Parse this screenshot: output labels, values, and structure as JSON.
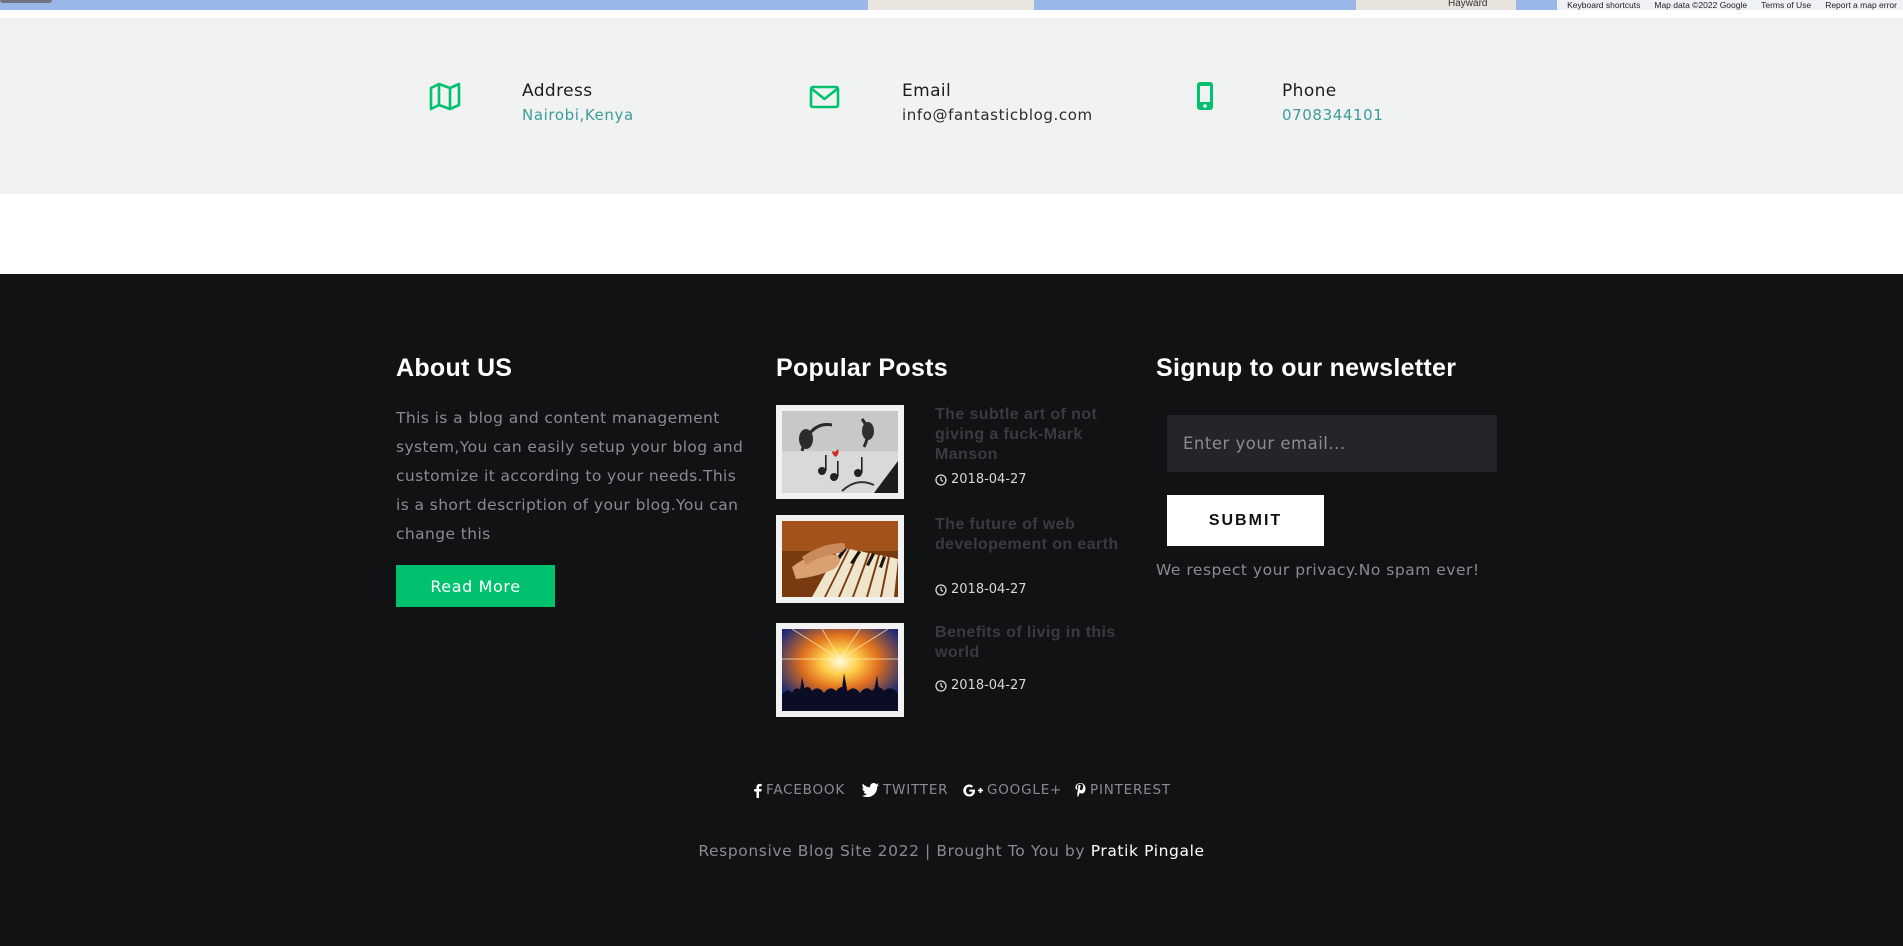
{
  "map": {
    "place_label": "Hayward",
    "attribution": [
      "Keyboard shortcuts",
      "Map data ©2022 Google",
      "Terms of Use",
      "Report a map error"
    ]
  },
  "contact": {
    "address": {
      "title": "Address",
      "value": "Nairobi,Kenya",
      "icon": "map-icon"
    },
    "email": {
      "title": "Email",
      "value": "info@fantasticblog.com",
      "icon": "envelope-icon"
    },
    "phone": {
      "title": "Phone",
      "value": "0708344101",
      "icon": "mobile-phone-icon"
    },
    "accent_color": "#00c16e"
  },
  "footer": {
    "about": {
      "title": "About US",
      "text": "This is a blog and content management system,You can easily setup your blog and customize it according to your needs.This is a short description of your blog.You can change this",
      "button": "Read More"
    },
    "popular": {
      "title": "Popular Posts",
      "posts": [
        {
          "title": "The subtle art of not giving a fuck-Mark Manson",
          "date": "2018-04-27",
          "image": "headphones-music-notes"
        },
        {
          "title": "The future of web developement on earth",
          "date": "2018-04-27",
          "image": "hands-on-piano"
        },
        {
          "title": "Benefits of livig in this world",
          "date": "2018-04-27",
          "image": "concert-lights"
        }
      ]
    },
    "newsletter": {
      "title": "Signup to our newsletter",
      "placeholder": "Enter your email...",
      "button": "SUBMIT",
      "note": "We respect your privacy.No spam ever!"
    },
    "social": [
      {
        "label": "FACEBOOK",
        "icon": "facebook-icon"
      },
      {
        "label": "TWITTER",
        "icon": "twitter-icon"
      },
      {
        "label": "GOOGLE+",
        "icon": "google-plus-icon"
      },
      {
        "label": "PINTEREST",
        "icon": "pinterest-icon"
      }
    ],
    "copyright": {
      "text": "Responsive Blog Site 2022 | Brought To You by",
      "author": "Pratik Pingale"
    }
  },
  "colors": {
    "accent": "#00c16e",
    "teal_text": "#3c9b9b",
    "footer_bg": "#111214",
    "contact_bg": "#f0f3f1"
  }
}
